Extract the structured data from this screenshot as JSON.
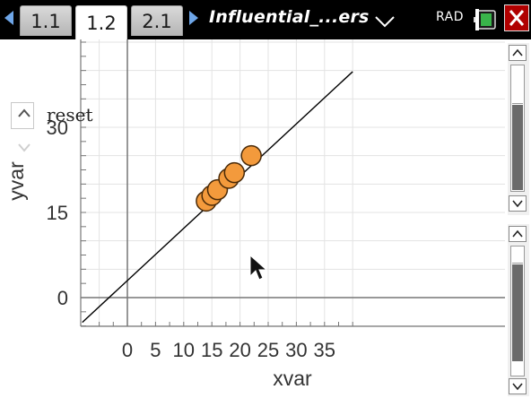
{
  "tabs": [
    {
      "label": "1.1",
      "active": false
    },
    {
      "label": "1.2",
      "active": true
    },
    {
      "label": "2.1",
      "active": false
    }
  ],
  "document": {
    "title": "Influential_...ers"
  },
  "status": {
    "angle_mode": "RAD",
    "battery_icon": "battery-icon",
    "close_icon": "close-icon"
  },
  "controls": {
    "reset_label": "reset"
  },
  "colors": {
    "point_fill": "#f39a3c",
    "close": "#b00000",
    "tab_arrow": "#6ea6e8"
  },
  "chart_data": {
    "type": "scatter",
    "xlabel": "xvar",
    "ylabel": "yvar",
    "xlim": [
      -5,
      40
    ],
    "ylim": [
      -2,
      45
    ],
    "x_ticks": [
      0,
      5,
      10,
      15,
      20,
      25,
      30,
      35
    ],
    "y_ticks": [
      0,
      15,
      30
    ],
    "grid": true,
    "points": [
      {
        "x": 14,
        "y": 17
      },
      {
        "x": 15,
        "y": 18
      },
      {
        "x": 16,
        "y": 19
      },
      {
        "x": 18,
        "y": 21
      },
      {
        "x": 19,
        "y": 22
      },
      {
        "x": 22,
        "y": 25
      }
    ],
    "regression_line": {
      "slope": 0.92,
      "intercept": 3.0
    }
  }
}
